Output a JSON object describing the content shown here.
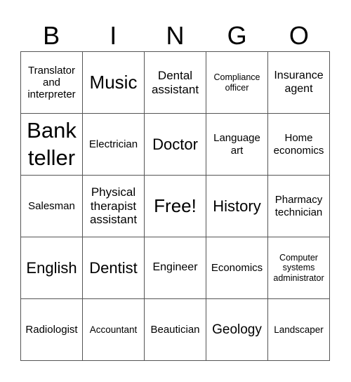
{
  "header": {
    "letters": [
      "B",
      "I",
      "N",
      "G",
      "O"
    ]
  },
  "cells": [
    [
      "Translator and interpreter",
      "Music",
      "Dental assistant",
      "Compliance officer",
      "Insurance agent"
    ],
    [
      "Bank teller",
      "Electrician",
      "Doctor",
      "Language art",
      "Home economics"
    ],
    [
      "Salesman",
      "Physical therapist assistant",
      "Free!",
      "History",
      "Pharmacy technician"
    ],
    [
      "English",
      "Dentist",
      "Engineer",
      "Economics",
      "Computer systems administrator"
    ],
    [
      "Radiologist",
      "Accountant",
      "Beautician",
      "Geology",
      "Landscaper"
    ]
  ]
}
